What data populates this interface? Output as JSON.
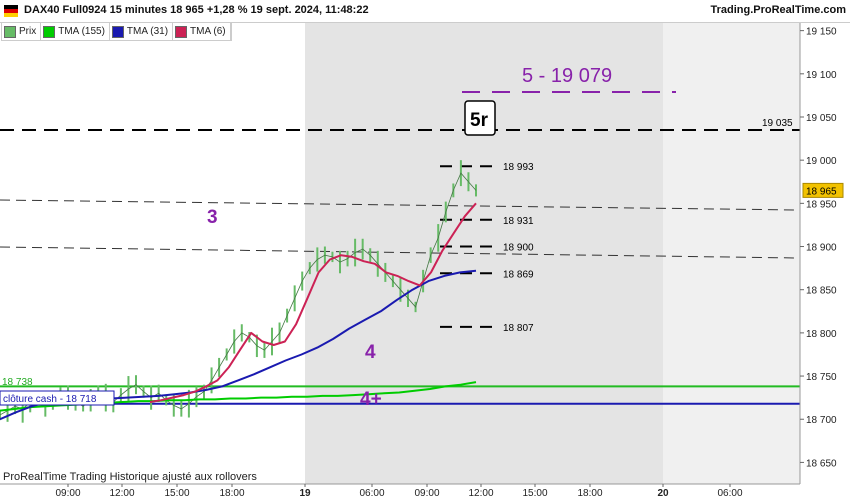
{
  "header": {
    "title": "DAX40 Full0924 15 minutes 18 965 +1,28 % 19 sept. 2024, 11:48:22",
    "brand": "Trading.ProRealTime.com"
  },
  "legend": [
    {
      "label": "Prix",
      "color": "#66bb66"
    },
    {
      "label": "TMA (155)",
      "color": "#00cc00"
    },
    {
      "label": "TMA (31)",
      "color": "#1a1ab0"
    },
    {
      "label": "TMA (6)",
      "color": "#cc2255"
    }
  ],
  "footer_note": "ProRealTime Trading  Historique ajusté aux rollovers",
  "chart_data": {
    "type": "line",
    "ylim": [
      18625,
      19160
    ],
    "y_ticks": [
      18650,
      18700,
      18750,
      18800,
      18850,
      18900,
      18950,
      19000,
      19050,
      19100,
      19150
    ],
    "y_tick_labels": [
      "18 650",
      "18 700",
      "18 750",
      "18 800",
      "18 850",
      "18 900",
      "18 950",
      "19 000",
      "19 050",
      "19 100",
      "19 150"
    ],
    "x_labels": [
      "09:00",
      "12:00",
      "15:00",
      "18:00",
      "19",
      "06:00",
      "09:00",
      "12:00",
      "15:00",
      "18:00",
      "20",
      "06:00"
    ],
    "current_price": {
      "value": 18965,
      "label": "18 965"
    },
    "series": [
      {
        "name": "Prix",
        "color": "#66bb66",
        "values": [
          18705,
          18710,
          18715,
          18712,
          18720,
          18725,
          18718,
          18722,
          18730,
          18725,
          18720,
          18715,
          18722,
          18730,
          18725,
          18720,
          18728,
          18735,
          18740,
          18732,
          18725,
          18730,
          18722,
          18716,
          18712,
          18718,
          18726,
          18732,
          18745,
          18760,
          18775,
          18790,
          18800,
          18795,
          18785,
          18780,
          18790,
          18800,
          18820,
          18840,
          18860,
          18875,
          18885,
          18890,
          18888,
          18882,
          18886,
          18893,
          18897,
          18890,
          18880,
          18870,
          18860,
          18850,
          18840,
          18830,
          18860,
          18890,
          18910,
          18940,
          18965,
          18985,
          18975,
          18965
        ]
      },
      {
        "name": "TMA (155)",
        "color": "#00cc00",
        "values": [
          18710,
          18712,
          18714,
          18715,
          18716,
          18717,
          18718,
          18719,
          18720,
          18721,
          18721,
          18722,
          18722,
          18723,
          18723,
          18724,
          18724,
          18725,
          18725,
          18726,
          18726,
          18727,
          18727,
          18728,
          18729,
          18730,
          18731,
          18733,
          18735,
          18738,
          18740,
          18743
        ]
      },
      {
        "name": "TMA (31)",
        "color": "#1a1ab0",
        "values": [
          18700,
          18708,
          18715,
          18720,
          18722,
          18723,
          18724,
          18724,
          18725,
          18726,
          18727,
          18729,
          18731,
          18734,
          18738,
          18745,
          18752,
          18760,
          18768,
          18775,
          18783,
          18793,
          18805,
          18815,
          18825,
          18838,
          18850,
          18860,
          18866,
          18870,
          18872
        ]
      },
      {
        "name": "TMA (6)",
        "color": "#cc2255",
        "values": [
          18720,
          18722,
          18725,
          18728,
          18732,
          18738,
          18745,
          18760,
          18780,
          18800,
          18790,
          18786,
          18790,
          18810,
          18840,
          18870,
          18885,
          18890,
          18888,
          18883,
          18880,
          18870,
          18866,
          18860,
          18855,
          18870,
          18895,
          18915,
          18935,
          18950
        ]
      }
    ],
    "h_lines": [
      {
        "label": "19 035",
        "value": 19035,
        "color": "#000000",
        "style": "dashed"
      },
      {
        "label": "5 - 19 079",
        "value": 19079,
        "color": "#8822aa",
        "style": "dashed"
      },
      {
        "label": "18 738",
        "value": 18738,
        "color": "#22bb22",
        "style": "solid"
      },
      {
        "label": "clôture cash -  18 718",
        "value": 18718,
        "color": "#1a1ab0",
        "style": "solid"
      }
    ],
    "level_labels": [
      {
        "label": "18 993",
        "value": 18993
      },
      {
        "label": "18 931",
        "value": 18931
      },
      {
        "label": "18 900",
        "value": 18900
      },
      {
        "label": "18 869",
        "value": 18869
      },
      {
        "label": "18 807",
        "value": 18807
      }
    ],
    "annotations": [
      {
        "text": "3",
        "color": "#8822aa"
      },
      {
        "text": "4",
        "color": "#8822aa"
      },
      {
        "text": "4+",
        "color": "#8822aa"
      },
      {
        "text": "5r",
        "color": "#000000"
      }
    ]
  }
}
